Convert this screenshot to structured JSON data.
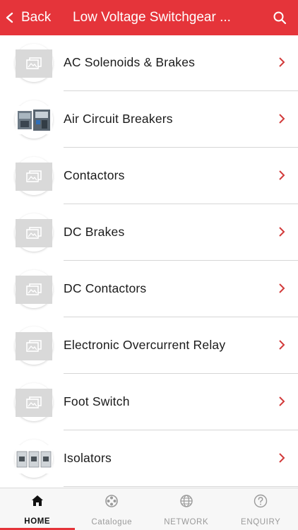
{
  "header": {
    "back_label": "Back",
    "title": "Low Voltage Switchgear ...",
    "background": "#e5343a"
  },
  "list": {
    "items": [
      {
        "label": "AC Solenoids & Brakes",
        "thumb": "placeholder"
      },
      {
        "label": "Air Circuit Breakers",
        "thumb": "photo"
      },
      {
        "label": "Contactors",
        "thumb": "placeholder"
      },
      {
        "label": "DC Brakes",
        "thumb": "placeholder"
      },
      {
        "label": "DC Contactors",
        "thumb": "placeholder"
      },
      {
        "label": "Electronic Overcurrent Relay",
        "thumb": "placeholder"
      },
      {
        "label": "Foot Switch",
        "thumb": "placeholder"
      },
      {
        "label": "Isolators",
        "thumb": "photo"
      }
    ]
  },
  "tabbar": {
    "tabs": [
      {
        "label": "HOME",
        "icon": "home-icon",
        "active": true
      },
      {
        "label": "Catalogue",
        "icon": "catalogue-icon",
        "active": false
      },
      {
        "label": "NETWORK",
        "icon": "globe-icon",
        "active": false
      },
      {
        "label": "ENQUIRY",
        "icon": "question-icon",
        "active": false
      }
    ]
  },
  "colors": {
    "accent": "#e5343a",
    "chevron": "#d23a3a",
    "divider": "#d6d6d6"
  }
}
